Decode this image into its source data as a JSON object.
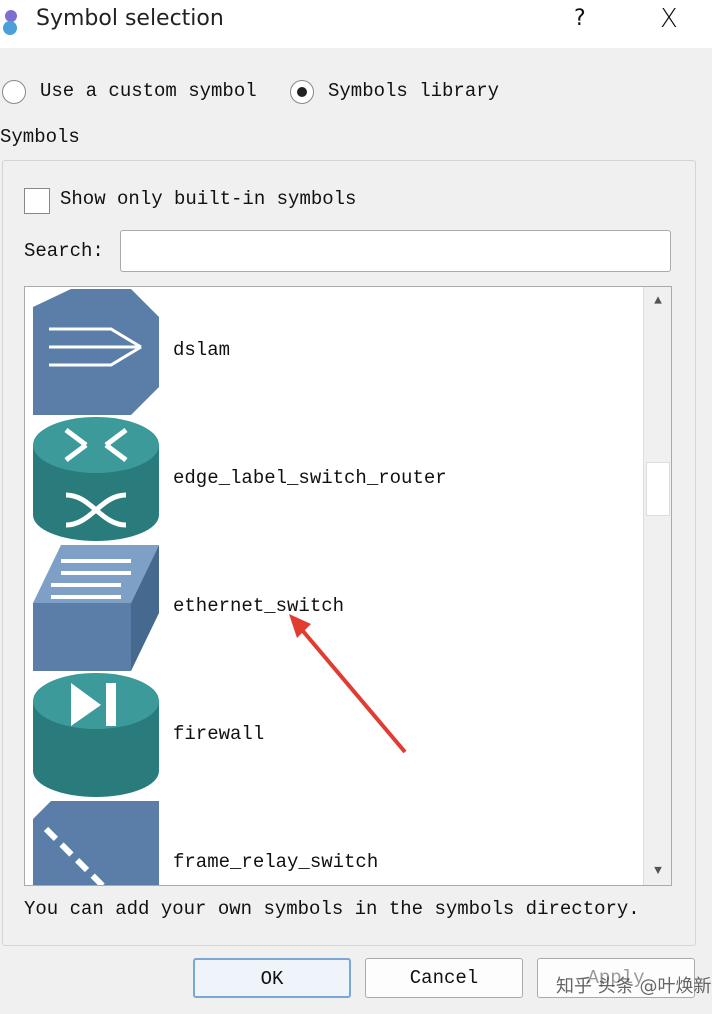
{
  "window": {
    "title": "Symbol selection",
    "help": "?",
    "close": "X"
  },
  "options": {
    "custom": "Use a custom symbol",
    "library": "Symbols library",
    "selected": "library"
  },
  "group_title": "Symbols",
  "builtin_only": {
    "label": "Show only built-in symbols",
    "checked": false
  },
  "search": {
    "label": "Search:",
    "value": ""
  },
  "symbols": [
    {
      "name": "dslam",
      "icon": "dslam-icon"
    },
    {
      "name": "edge_label_switch_router",
      "icon": "router-icon"
    },
    {
      "name": "ethernet_switch",
      "icon": "switch-icon"
    },
    {
      "name": "firewall",
      "icon": "firewall-icon"
    },
    {
      "name": "frame_relay_switch",
      "icon": "frame-relay-icon"
    }
  ],
  "hint": "You can add your own symbols in the symbols directory.",
  "buttons": {
    "ok": "OK",
    "cancel": "Cancel",
    "apply": "Apply"
  },
  "watermark": "知乎 头条 @叶焕新",
  "colors": {
    "blue_symbol": "#5a7ea8",
    "teal_symbol": "#2a7c7c",
    "annotation_arrow": "#e03c31"
  }
}
